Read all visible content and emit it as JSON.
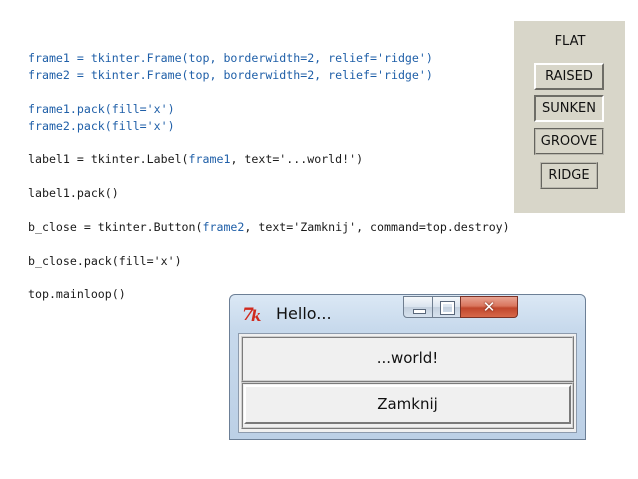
{
  "code": {
    "lines": [
      {
        "parts": [
          {
            "text": "frame1 = tkinter.Frame(top, borderwidth=2, relief='ridge')",
            "color": "blue"
          }
        ]
      },
      {
        "parts": [
          {
            "text": "frame2 = tkinter.Frame(top, borderwidth=2, relief='ridge')",
            "color": "blue"
          }
        ]
      },
      {
        "parts": []
      },
      {
        "parts": [
          {
            "text": "frame1.pack(fill='x')",
            "color": "blue"
          }
        ]
      },
      {
        "parts": [
          {
            "text": "frame2.pack(fill='x')",
            "color": "blue"
          }
        ]
      },
      {
        "parts": []
      },
      {
        "parts": [
          {
            "text": "label1 = tkinter.Label(",
            "color": "dark"
          },
          {
            "text": "frame1",
            "color": "blue"
          },
          {
            "text": ", text='...world!')",
            "color": "dark"
          }
        ]
      },
      {
        "parts": []
      },
      {
        "parts": [
          {
            "text": "label1.pack()",
            "color": "dark"
          }
        ]
      },
      {
        "parts": []
      },
      {
        "parts": [
          {
            "text": "b_close = tkinter.Button(",
            "color": "dark"
          },
          {
            "text": "frame2",
            "color": "blue"
          },
          {
            "text": ", text='Zamknij', command=top.destroy)",
            "color": "dark"
          }
        ]
      },
      {
        "parts": []
      },
      {
        "parts": [
          {
            "text": "b_close.pack(fill='x')",
            "color": "dark"
          }
        ]
      },
      {
        "parts": []
      },
      {
        "parts": [
          {
            "text": "top.mainloop()",
            "color": "dark"
          }
        ]
      }
    ]
  },
  "relief_demo": {
    "flat": "FLAT",
    "raised": "RAISED",
    "sunken": "SUNKEN",
    "groove": "GROOVE",
    "ridge": "RIDGE"
  },
  "tk_window": {
    "title": "Hello...",
    "label_text": "...world!",
    "button_text": "Zamknij",
    "icons": {
      "app": "tk-feather-logo-icon",
      "minimize": "minimize-icon",
      "maximize": "maximize-icon",
      "close": "close-icon"
    }
  },
  "colors": {
    "code_blue": "#1f5fa8",
    "code_dark": "#1a1a1a",
    "relief_panel_bg": "#d8d6c9",
    "titlebar": "#c7d9ec",
    "close_button": "#c0462c",
    "tk_logo_red": "#d02a1e"
  }
}
